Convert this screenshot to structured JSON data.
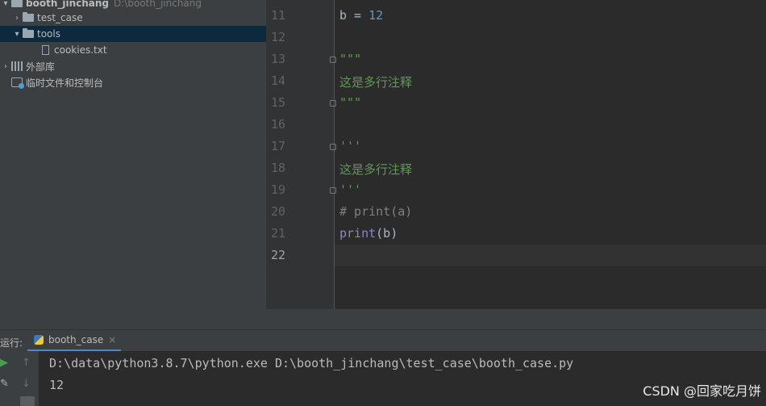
{
  "project": {
    "root_name": "booth_jinchang",
    "root_path": "D:\\booth_jinchang",
    "items": [
      {
        "label": "test_case"
      },
      {
        "label": "tools"
      },
      {
        "label": "cookies.txt"
      }
    ],
    "external_libs": "外部库",
    "scratches": "临时文件和控制台"
  },
  "editor": {
    "lines": [
      {
        "no": "11",
        "text": "b = 12"
      },
      {
        "no": "12",
        "text": ""
      },
      {
        "no": "13",
        "text": "\"\"\""
      },
      {
        "no": "14",
        "text": "这是多行注释"
      },
      {
        "no": "15",
        "text": "\"\"\""
      },
      {
        "no": "16",
        "text": ""
      },
      {
        "no": "17",
        "text": "'''"
      },
      {
        "no": "18",
        "text": "这是多行注释"
      },
      {
        "no": "19",
        "text": "'''"
      },
      {
        "no": "20",
        "text": "# print(a)"
      },
      {
        "no": "21",
        "text": "print(b)"
      },
      {
        "no": "22",
        "text": ""
      }
    ]
  },
  "run": {
    "label": "运行:",
    "tab": "booth_case",
    "command": "D:\\data\\python3.8.7\\python.exe D:\\booth_jinchang\\test_case\\booth_case.py",
    "output": "12"
  },
  "watermark": "CSDN @回家吃月饼",
  "colors": {
    "number": "#6897bb",
    "docstring": "#629755",
    "comment": "#808080",
    "builtin": "#8888c6",
    "text": "#a9b7c6",
    "run_green": "#499c54"
  }
}
